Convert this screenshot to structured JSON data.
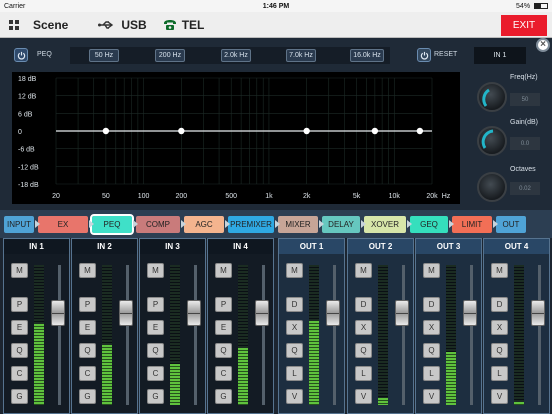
{
  "status": {
    "carrier": "Carrier",
    "time": "1:46 PM",
    "battery": "54%",
    "battery_level": 0.54
  },
  "nav": {
    "scene": "Scene",
    "usb": "USB",
    "tel": "TEL",
    "exit": "EXIT"
  },
  "peq": {
    "label": "PEQ",
    "bands": [
      "50 Hz",
      "200 Hz",
      "2.0k Hz",
      "7.0k Hz",
      "16.0k Hz"
    ],
    "reset": "RESET",
    "channel": "IN 1",
    "freq_label": "Freq(Hz)",
    "freq_value": "50",
    "gain_label": "Gain(dB)",
    "gain_value": "0.0",
    "oct_label": "Octaves",
    "oct_value": "0.02"
  },
  "chart_data": {
    "type": "line",
    "y_ticks": [
      "18 dB",
      "12 dB",
      "6 dB",
      "0",
      "-6 dB",
      "-12 dB",
      "-18 dB"
    ],
    "x_ticks": [
      "20",
      "50",
      "100",
      "200",
      "500",
      "1k",
      "2k",
      "5k",
      "10k",
      "20k",
      "Hz"
    ],
    "ylim": [
      -18,
      18
    ],
    "xlim": [
      20,
      20000
    ],
    "x_scale": "log",
    "grid": true,
    "series": [
      {
        "x": [
          50,
          200,
          2000,
          7000,
          16000
        ],
        "y": [
          0,
          0,
          0,
          0,
          0
        ]
      }
    ]
  },
  "modules": [
    {
      "label": "INPUT",
      "color": "#4fa3d6",
      "selected": false
    },
    {
      "label": "EX",
      "color": "#e8756b",
      "selected": false
    },
    {
      "label": "PEQ",
      "color": "#3fe0c8",
      "selected": true
    },
    {
      "label": "COMP",
      "color": "#c97b7b",
      "selected": false
    },
    {
      "label": "AGC",
      "color": "#f4b48e",
      "selected": false
    },
    {
      "label": "PREMIXER",
      "color": "#2fa9e3",
      "selected": false
    },
    {
      "label": "MIXER",
      "color": "#c7a597",
      "selected": false
    },
    {
      "label": "DELAY",
      "color": "#66c7bf",
      "selected": false
    },
    {
      "label": "XOVER",
      "color": "#d7e6a9",
      "selected": false
    },
    {
      "label": "GEQ",
      "color": "#35dfbd",
      "selected": false
    },
    {
      "label": "LIMIT",
      "color": "#f26f56",
      "selected": false
    },
    {
      "label": "OUT",
      "color": "#4fa3d6",
      "selected": false
    }
  ],
  "channels": [
    {
      "name": "IN 1",
      "kind": "in",
      "buttons": [
        "M",
        "P",
        "E",
        "Q",
        "C",
        "G"
      ],
      "level": 0.58,
      "fader": 0.66
    },
    {
      "name": "IN 2",
      "kind": "in",
      "buttons": [
        "M",
        "P",
        "E",
        "Q",
        "C",
        "G"
      ],
      "level": 0.43,
      "fader": 0.66
    },
    {
      "name": "IN 3",
      "kind": "in",
      "buttons": [
        "M",
        "P",
        "E",
        "Q",
        "C",
        "G"
      ],
      "level": 0.29,
      "fader": 0.66
    },
    {
      "name": "IN 4",
      "kind": "in",
      "buttons": [
        "M",
        "P",
        "E",
        "Q",
        "C",
        "G"
      ],
      "level": 0.41,
      "fader": 0.66
    },
    {
      "name": "OUT 1",
      "kind": "out",
      "buttons": [
        "M",
        "D",
        "X",
        "Q",
        "L",
        "V"
      ],
      "level": 0.6,
      "fader": 0.66
    },
    {
      "name": "OUT 2",
      "kind": "out",
      "buttons": [
        "M",
        "D",
        "X",
        "Q",
        "L",
        "V"
      ],
      "level": 0.05,
      "fader": 0.66
    },
    {
      "name": "OUT 3",
      "kind": "out",
      "buttons": [
        "M",
        "D",
        "X",
        "Q",
        "L",
        "V"
      ],
      "level": 0.38,
      "fader": 0.66
    },
    {
      "name": "OUT 4",
      "kind": "out",
      "buttons": [
        "M",
        "D",
        "X",
        "Q",
        "L",
        "V"
      ],
      "level": 0.02,
      "fader": 0.66
    }
  ]
}
